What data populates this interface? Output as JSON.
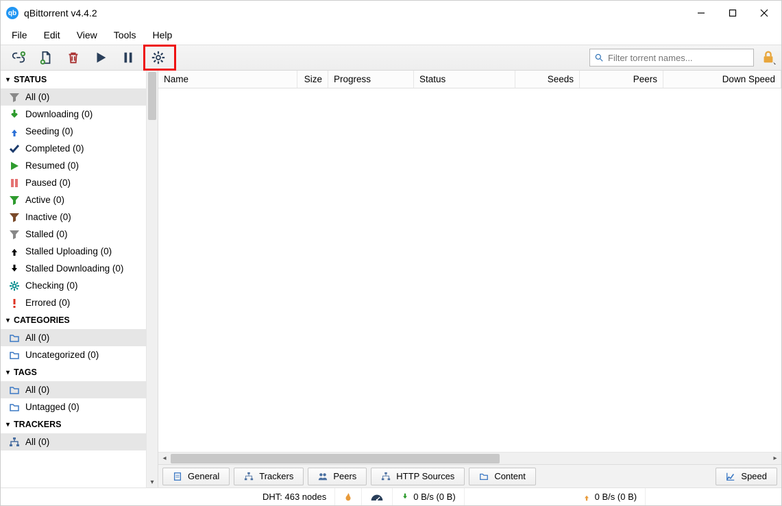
{
  "titlebar": {
    "title": "qBittorrent v4.4.2"
  },
  "menu": {
    "file": "File",
    "edit": "Edit",
    "view": "View",
    "tools": "Tools",
    "help": "Help"
  },
  "search": {
    "placeholder": "Filter torrent names..."
  },
  "sidebar": {
    "status": {
      "title": "STATUS",
      "items": [
        {
          "label": "All (0)"
        },
        {
          "label": "Downloading (0)"
        },
        {
          "label": "Seeding (0)"
        },
        {
          "label": "Completed (0)"
        },
        {
          "label": "Resumed (0)"
        },
        {
          "label": "Paused (0)"
        },
        {
          "label": "Active (0)"
        },
        {
          "label": "Inactive (0)"
        },
        {
          "label": "Stalled (0)"
        },
        {
          "label": "Stalled Uploading (0)"
        },
        {
          "label": "Stalled Downloading (0)"
        },
        {
          "label": "Checking (0)"
        },
        {
          "label": "Errored (0)"
        }
      ]
    },
    "categories": {
      "title": "CATEGORIES",
      "items": [
        {
          "label": "All (0)"
        },
        {
          "label": "Uncategorized (0)"
        }
      ]
    },
    "tags": {
      "title": "TAGS",
      "items": [
        {
          "label": "All (0)"
        },
        {
          "label": "Untagged (0)"
        }
      ]
    },
    "trackers": {
      "title": "TRACKERS",
      "items": [
        {
          "label": "All (0)"
        }
      ]
    }
  },
  "columns": {
    "name": "Name",
    "size": "Size",
    "progress": "Progress",
    "status": "Status",
    "seeds": "Seeds",
    "peers": "Peers",
    "dspeed": "Down Speed"
  },
  "tabs": {
    "general": "General",
    "trackers": "Trackers",
    "peers": "Peers",
    "http": "HTTP Sources",
    "content": "Content",
    "speed": "Speed"
  },
  "status": {
    "dht": "DHT: 463 nodes",
    "down": "0 B/s (0 B)",
    "up": "0 B/s (0 B)"
  }
}
